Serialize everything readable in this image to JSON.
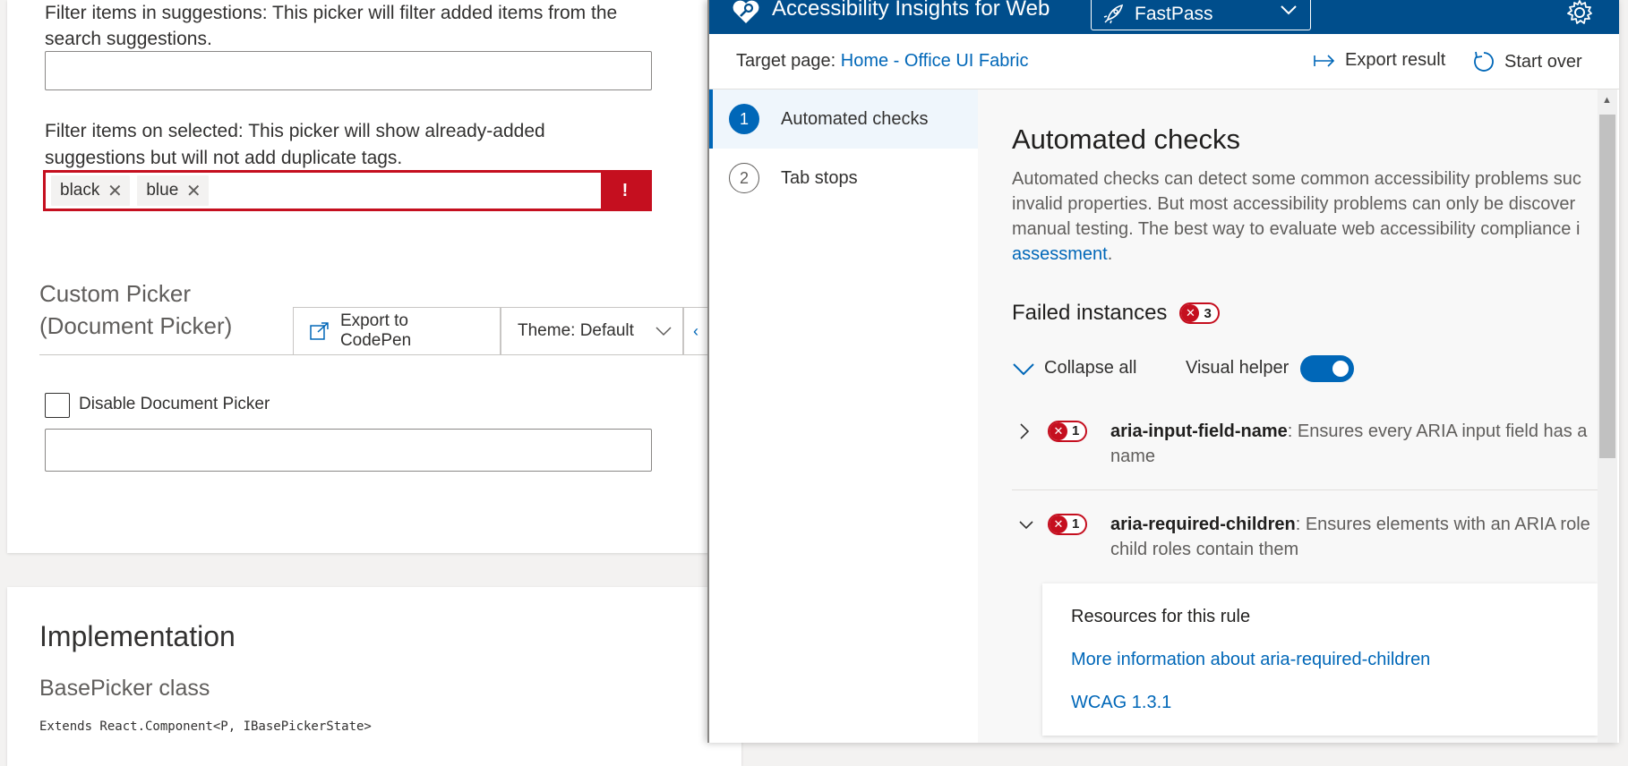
{
  "bg": {
    "filter_suggestions_label": "Filter items in suggestions: This picker will filter added items from the",
    "filter_suggestions_label2": "search suggestions.",
    "filter_selected_label": "Filter items on selected: This picker will show already-added",
    "filter_selected_label2": "suggestions but will not add duplicate tags.",
    "tags": [
      "black",
      "blue"
    ],
    "error_glyph": "!",
    "custom_picker_title1": "Custom Picker",
    "custom_picker_title2": "(Document Picker)",
    "export_codepen": "Export to CodePen",
    "theme": "Theme: Default",
    "disable_label": "Disable Document Picker",
    "impl_title": "Implementation",
    "impl_sub": "BasePicker class",
    "extends": "Extends React.Component<P, IBasePickerState>"
  },
  "ai": {
    "app_title": "Accessibility Insights for Web",
    "mode": "FastPass",
    "target_label": "Target page:",
    "target_link": "Home - Office UI Fabric",
    "export_result": "Export result",
    "start_over": "Start over",
    "nav": [
      {
        "num": "1",
        "label": "Automated checks"
      },
      {
        "num": "2",
        "label": "Tab stops"
      }
    ],
    "title": "Automated checks",
    "desc1": "Automated checks can detect some common accessibility problems suc",
    "desc2": "invalid properties. But most accessibility problems can only be discover",
    "desc3": "manual testing. The best way to evaluate web accessibility compliance i",
    "desc_link": "assessment",
    "desc_end": ".",
    "failed_label": "Failed instances",
    "failed_count": "3",
    "collapse_all": "Collapse all",
    "visual_helper": "Visual helper",
    "rules": [
      {
        "count": "1",
        "name": "aria-input-field-name",
        "desc1": ": Ensures every ARIA input field has a",
        "desc2": "name"
      },
      {
        "count": "1",
        "name": "aria-required-children",
        "desc1": ": Ensures elements with an ARIA role",
        "desc2": "child roles contain them"
      }
    ],
    "resources_title": "Resources for this rule",
    "resources_link1": "More information about aria-required-children",
    "resources_link2": "WCAG 1.3.1"
  },
  "colors": {
    "header": "#004e8c",
    "accent": "#0067b8",
    "error": "#c50f1f"
  }
}
